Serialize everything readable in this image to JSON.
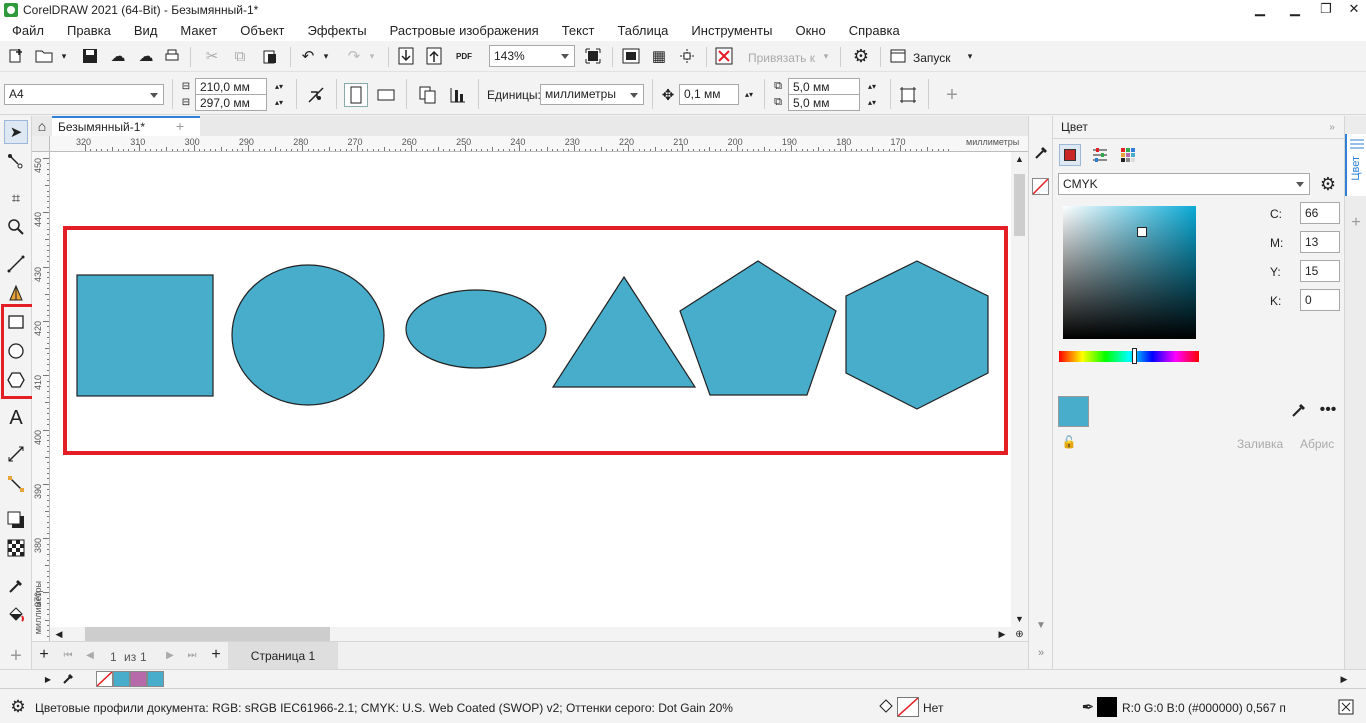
{
  "window": {
    "title": "CorelDRAW 2021 (64-Bit) - Безымянный-1*",
    "minimize": "▁",
    "restore": "❐",
    "close": "✕"
  },
  "menu": [
    "Файл",
    "Правка",
    "Вид",
    "Макет",
    "Объект",
    "Эффекты",
    "Растровые изображения",
    "Текст",
    "Таблица",
    "Инструменты",
    "Окно",
    "Справка"
  ],
  "toolbar": {
    "zoom": "143%",
    "snap_label": "Привязать к",
    "launch_label": "Запуск"
  },
  "property_bar": {
    "page_size": "A4",
    "width": "210,0 мм",
    "height": "297,0 мм",
    "units_label": "Единицы:",
    "units_value": "миллиметры",
    "nudge": "0,1 мм",
    "dup_x": "5,0 мм",
    "dup_y": "5,0 мм"
  },
  "document_tab": {
    "title": "Безымянный-1*"
  },
  "ruler": {
    "h_ticks": [
      "320",
      "310",
      "300",
      "290",
      "280",
      "270",
      "260",
      "250",
      "240",
      "230",
      "220",
      "210",
      "200",
      "190",
      "180",
      "170"
    ],
    "h_unit": "миллиметры",
    "v_ticks": [
      "450",
      "440",
      "430",
      "420",
      "410",
      "400",
      "390",
      "380",
      "370"
    ],
    "v_unit": "миллиметры"
  },
  "shapes": {
    "fill": "#48accb",
    "stroke": "#222222",
    "highlight": "#e31e24"
  },
  "pages": {
    "current": "1",
    "of": "из",
    "total": "1",
    "tab_label": "Страница 1"
  },
  "color_panel": {
    "title": "Цвет",
    "model": "CMYK",
    "c_label": "C:",
    "c_value": "66",
    "m_label": "M:",
    "m_value": "13",
    "y_label": "Y:",
    "y_value": "15",
    "k_label": "K:",
    "k_value": "0",
    "swatch": "#48accb",
    "fill_label": "Заливка",
    "outline_label": "Абрис",
    "side_tab": "Цвет"
  },
  "palette": [
    "#48accb",
    "#b66aa9",
    "#48accb"
  ],
  "status": {
    "profiles": "Цветовые профили документа: RGB: sRGB IEC61966-2.1; CMYK: U.S. Web Coated (SWOP) v2; Оттенки серого: Dot Gain 20%",
    "fill_none": "Нет",
    "outline_info": "R:0 G:0 B:0 (#000000)  0,567 п"
  }
}
